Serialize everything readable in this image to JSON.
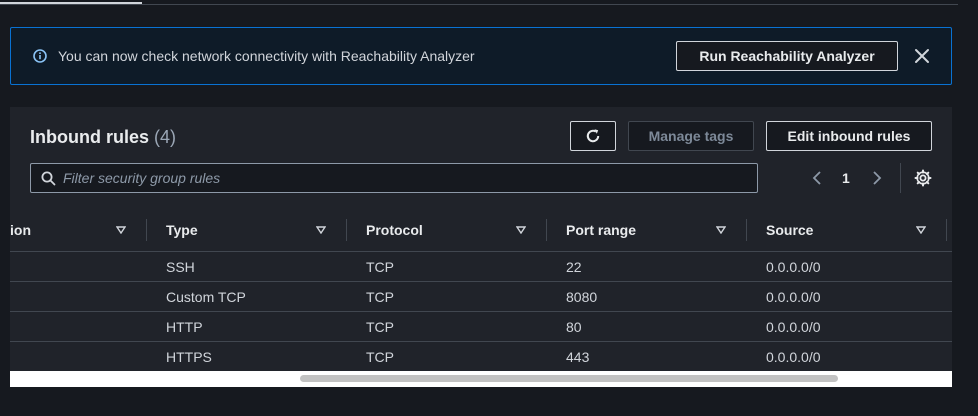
{
  "flash": {
    "message": "You can now check network connectivity with Reachability Analyzer",
    "button_label": "Run Reachability Analyzer",
    "icon": "info-icon",
    "close_icon": "close-icon"
  },
  "panel": {
    "title": "Inbound rules",
    "count": "(4)",
    "refresh_icon": "refresh-icon",
    "manage_tags_label": "Manage tags",
    "edit_label": "Edit inbound rules"
  },
  "filter": {
    "placeholder": "Filter security group rules",
    "value": ""
  },
  "pagination": {
    "current_page": "1"
  },
  "table": {
    "columns": [
      "ion",
      "Type",
      "Protocol",
      "Port range",
      "Source"
    ],
    "rows": [
      {
        "type": "SSH",
        "protocol": "TCP",
        "port": "22",
        "source": "0.0.0.0/0"
      },
      {
        "type": "Custom TCP",
        "protocol": "TCP",
        "port": "8080",
        "source": "0.0.0.0/0"
      },
      {
        "type": "HTTP",
        "protocol": "TCP",
        "port": "80",
        "source": "0.0.0.0/0"
      },
      {
        "type": "HTTPS",
        "protocol": "TCP",
        "port": "443",
        "source": "0.0.0.0/0"
      }
    ]
  },
  "colors": {
    "background": "#16191f",
    "info_accent": "#0972d3",
    "panel": "#20232a"
  }
}
